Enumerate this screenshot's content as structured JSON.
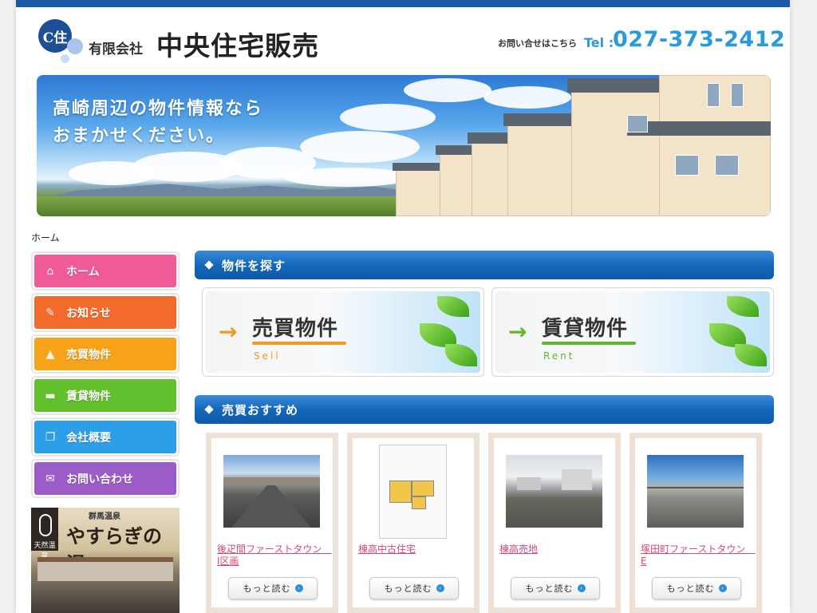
{
  "header": {
    "logo_mark": "C住",
    "company_prefix": "有限会社",
    "company_name": "中央住宅販売",
    "contact_label": "お問い合せはこちら",
    "tel_label": "Tel :",
    "tel_number": "027-373-2412"
  },
  "hero": {
    "line1": "高崎周辺の物件情報なら",
    "line2": "おまかせください。"
  },
  "breadcrumb": "ホーム",
  "nav": [
    {
      "label": "ホーム",
      "icon": "house-icon",
      "glyph": "⌂",
      "color": "#f05a97"
    },
    {
      "label": "お知らせ",
      "icon": "pushpin-icon",
      "glyph": "✎",
      "color": "#f26b2c"
    },
    {
      "label": "売買物件",
      "icon": "tshirt-icon",
      "glyph": "▲",
      "color": "#f7a31a"
    },
    {
      "label": "賃貸物件",
      "icon": "folder-icon",
      "glyph": "▬",
      "color": "#62bf2d"
    },
    {
      "label": "会社概要",
      "icon": "document-icon",
      "glyph": "❐",
      "color": "#2d9ee8"
    },
    {
      "label": "お問い合わせ",
      "icon": "mail-icon",
      "glyph": "✉",
      "color": "#9b5cc8"
    }
  ],
  "banner": {
    "label_left": "天然温泉",
    "onsen": "群馬温泉",
    "title": "やすらぎの湯"
  },
  "sections": {
    "search": "物件を探す",
    "recommend": "売買おすすめ"
  },
  "categories": [
    {
      "title": "売買物件",
      "sub": "Sell",
      "arrow": "→",
      "color": "#f39a1e"
    },
    {
      "title": "賃貸物件",
      "sub": "Rent",
      "arrow": "→",
      "color": "#62b52b"
    }
  ],
  "properties": [
    {
      "title": "後疋間ファーストタウン　Ⅰ区画"
    },
    {
      "title": "棟高中古住宅"
    },
    {
      "title": "棟高売地"
    },
    {
      "title": "塚田町ファーストタウン　E"
    }
  ],
  "more_label": "もっと読む",
  "more_glyph": "›"
}
